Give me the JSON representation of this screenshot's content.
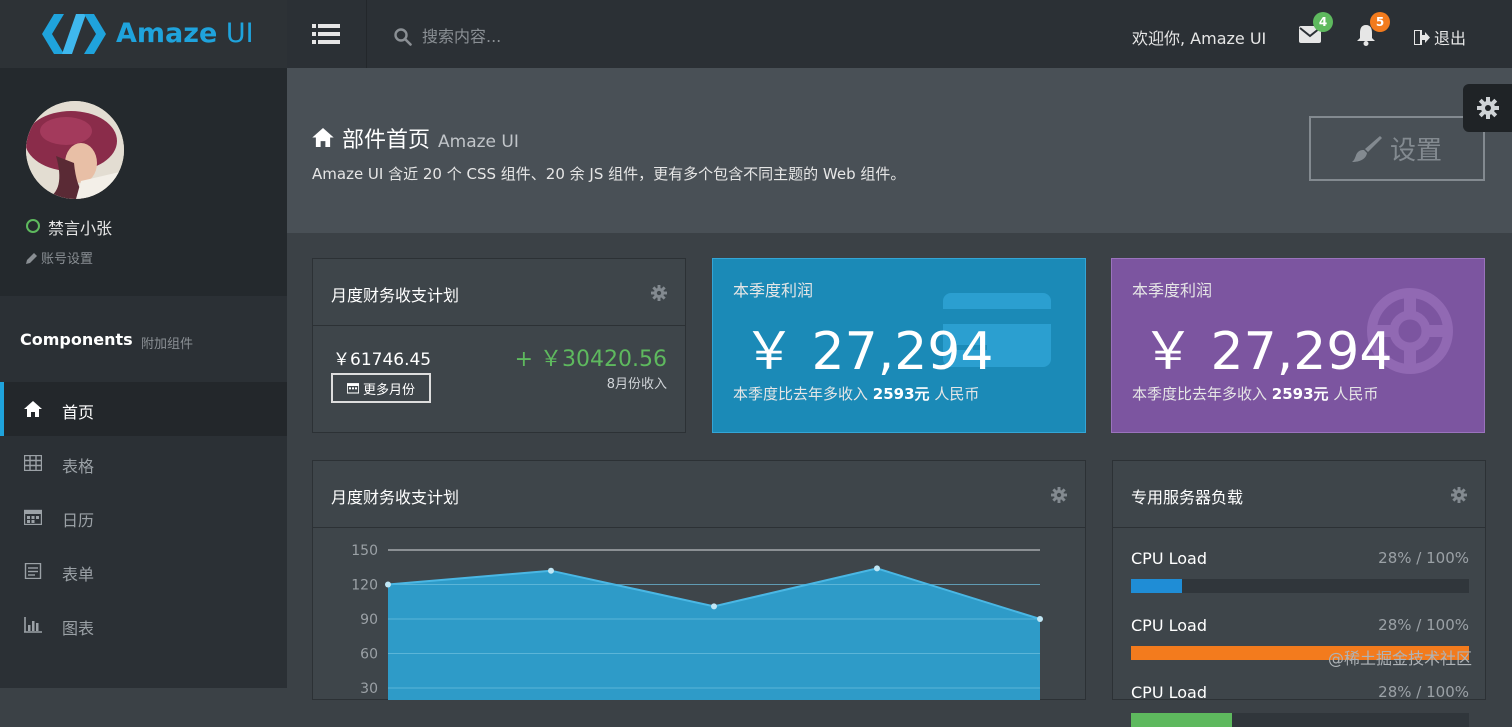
{
  "app": {
    "logo_text": "Amaze",
    "logo_suffix": "UI",
    "search_placeholder": "搜索内容...",
    "welcome": "欢迎你, Amaze UI",
    "mail_count": "4",
    "notification_count": "5",
    "logout": "退出",
    "colors": {
      "accent": "#1fa3dc",
      "success": "#5eb95e",
      "warning": "#f37b1d",
      "purple": "#7c55a0"
    }
  },
  "sidebar": {
    "user_name": "禁言小张",
    "account_settings": "账号设置",
    "section_title": "Components",
    "section_subtitle": "附加组件",
    "items": [
      {
        "label": "首页",
        "icon": "home-icon",
        "active": true
      },
      {
        "label": "表格",
        "icon": "table-icon"
      },
      {
        "label": "日历",
        "icon": "calendar-icon"
      },
      {
        "label": "表单",
        "icon": "form-icon"
      },
      {
        "label": "图表",
        "icon": "bar-chart-icon"
      }
    ]
  },
  "page": {
    "title": "部件首页",
    "subtitle": "Amaze UI",
    "description": "Amaze UI 含近 20 个 CSS 组件、20 余 JS 组件，更有多个包含不同主题的 Web 组件。",
    "settings_button": "设置"
  },
  "budget_card": {
    "title": "月度财务收支计划",
    "amount": "￥61746.45",
    "more_button": "更多月份",
    "income": "+ ￥30420.56",
    "income_label": "8月份收入"
  },
  "stat_cards": [
    {
      "label": "本季度利润",
      "value": "￥ 27,294",
      "foot_prefix": "本季度比去年多收入",
      "foot_amount": "2593元",
      "foot_suffix": "人民币",
      "icon": "credit-card-icon"
    },
    {
      "label": "本季度利润",
      "value": "￥ 27,294",
      "foot_prefix": "本季度比去年多收入",
      "foot_amount": "2593元",
      "foot_suffix": "人民币",
      "icon": "life-ring-icon"
    }
  ],
  "chart_card": {
    "title": "月度财务收支计划"
  },
  "chart_data": {
    "type": "area",
    "x": [
      1,
      2,
      3,
      4,
      5
    ],
    "values": [
      120,
      132,
      101,
      134,
      90
    ],
    "y_ticks": [
      150,
      120,
      90,
      60,
      30
    ],
    "ylim": [
      0,
      150
    ],
    "grid": true,
    "color": "#2e9bc8"
  },
  "server_card": {
    "title": "专用服务器负载",
    "loads": [
      {
        "label": "CPU Load",
        "value": "28% / 100%",
        "fraction": 0.15,
        "color": "#1f8dd6"
      },
      {
        "label": "CPU Load",
        "value": "28% / 100%",
        "fraction": 1.0,
        "color": "#f37b1d"
      },
      {
        "label": "CPU Load",
        "value": "28% / 100%",
        "fraction": 0.3,
        "color": "#5eb95e"
      }
    ]
  },
  "watermark": "@稀土掘金技术社区"
}
